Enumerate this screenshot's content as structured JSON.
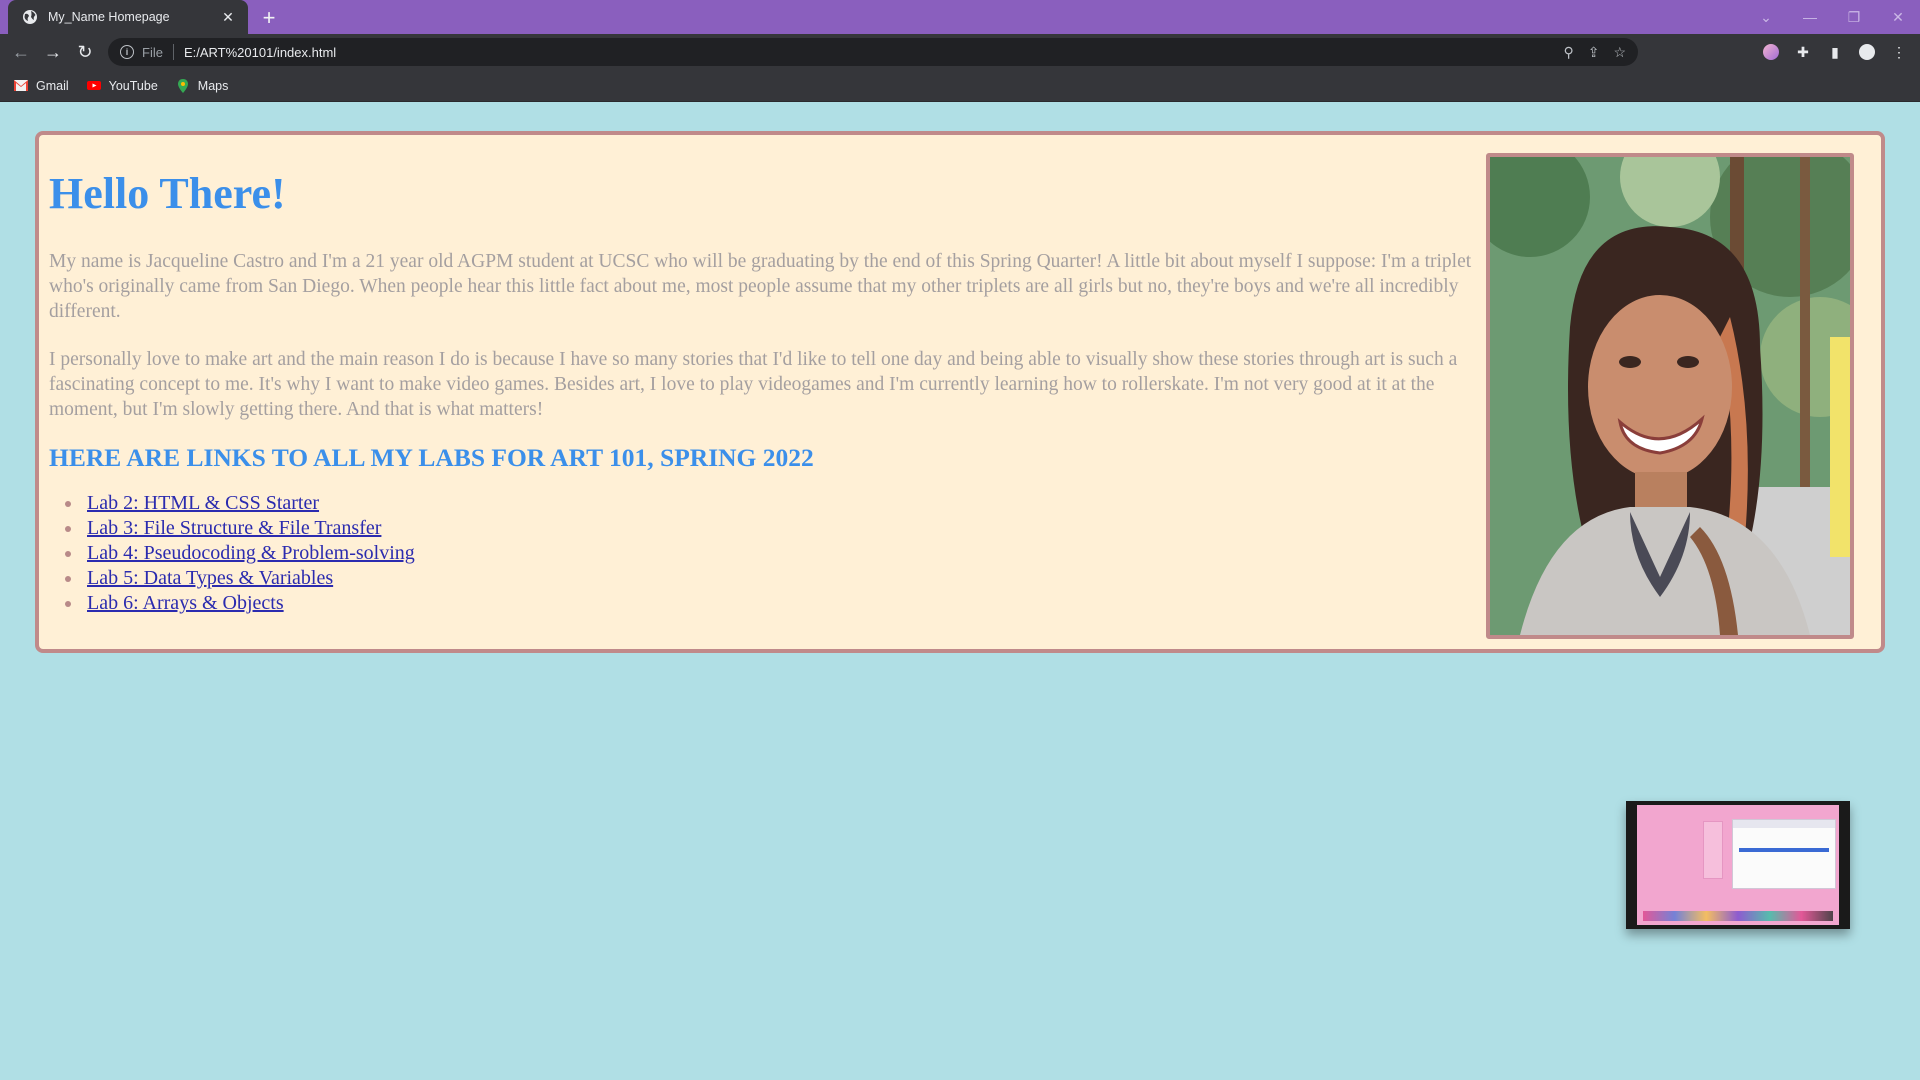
{
  "browser": {
    "tab_title": "My_Name Homepage",
    "tab_close": "✕",
    "new_tab": "+",
    "url_scheme": "File",
    "url": "E:/ART%20101/index.html",
    "window_controls": [
      "⌄",
      "—",
      "❐",
      "✕"
    ],
    "bookmarks": [
      {
        "label": "Gmail",
        "icon": "gmail-icon",
        "color": "#ea4335"
      },
      {
        "label": "YouTube",
        "icon": "youtube-icon",
        "color": "#ff0000"
      },
      {
        "label": "Maps",
        "icon": "maps-icon",
        "color": "#34a853"
      }
    ],
    "colors": {
      "titlebar": "#8a5fbe",
      "toolbar": "#35363a"
    }
  },
  "page": {
    "heading": "Hello There!",
    "paragraph1": "My name is Jacqueline Castro and I'm a 21 year old AGPM student at UCSC who will be graduating by the end of this Spring Quarter! A little bit about myself I suppose: I'm a triplet who's originally came from San Diego. When people hear this little fact about me, most people assume that my other triplets are all girls but no, they're boys and we're all incredibly different.",
    "paragraph2": "I personally love to make art and the main reason I do is because I have so many stories that I'd like to tell one day and being able to visually show these stories through art is such a fascinating concept to me. It's why I want to make video games. Besides art, I love to play videogames and I'm currently learning how to rollerskate. I'm not very good at it at the moment, but I'm slowly getting there. And that is what matters!",
    "links_heading": "HERE ARE LINKS TO ALL MY LABS FOR ART 101, SPRING 2022",
    "labs": [
      "Lab 2: HTML & CSS Starter",
      "Lab 3: File Structure & File Transfer",
      "Lab 4: Pseudocoding & Problem-solving",
      "Lab 5: Data Types & Variables",
      "Lab 6: Arrays & Objects"
    ],
    "colors": {
      "background": "#b0dfe5",
      "card": "#fff0d6",
      "border": "#c08a8a",
      "heading": "#3b8fea",
      "body_text": "#a49fa0",
      "link": "#2b2baf"
    }
  }
}
